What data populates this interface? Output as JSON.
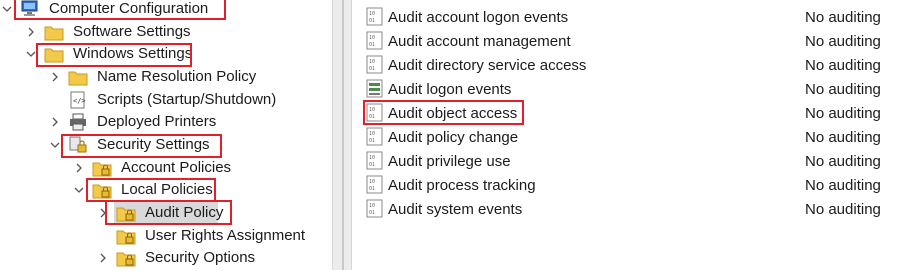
{
  "tree": {
    "computer_configuration": "Computer Configuration",
    "software_settings": "Software Settings",
    "windows_settings": "Windows Settings",
    "name_resolution_policy": "Name Resolution Policy",
    "scripts": "Scripts (Startup/Shutdown)",
    "deployed_printers": "Deployed Printers",
    "security_settings": "Security Settings",
    "account_policies": "Account Policies",
    "local_policies": "Local Policies",
    "audit_policy": "Audit Policy",
    "user_rights_assignment": "User Rights Assignment",
    "security_options": "Security Options"
  },
  "policies": [
    {
      "name": "Audit account logon events",
      "setting": "No auditing",
      "icon": "policy-icon"
    },
    {
      "name": "Audit account management",
      "setting": "No auditing",
      "icon": "policy-icon"
    },
    {
      "name": "Audit directory service access",
      "setting": "No auditing",
      "icon": "policy-icon"
    },
    {
      "name": "Audit logon events",
      "setting": "No auditing",
      "icon": "policy-server-icon"
    },
    {
      "name": "Audit object access",
      "setting": "No auditing",
      "icon": "policy-icon"
    },
    {
      "name": "Audit policy change",
      "setting": "No auditing",
      "icon": "policy-icon"
    },
    {
      "name": "Audit privilege use",
      "setting": "No auditing",
      "icon": "policy-icon"
    },
    {
      "name": "Audit process tracking",
      "setting": "No auditing",
      "icon": "policy-icon"
    },
    {
      "name": "Audit system events",
      "setting": "No auditing",
      "icon": "policy-icon"
    }
  ],
  "colors": {
    "highlight": "#e0202a",
    "folder": "#f3c94a",
    "selection": "#d9d9d9"
  }
}
